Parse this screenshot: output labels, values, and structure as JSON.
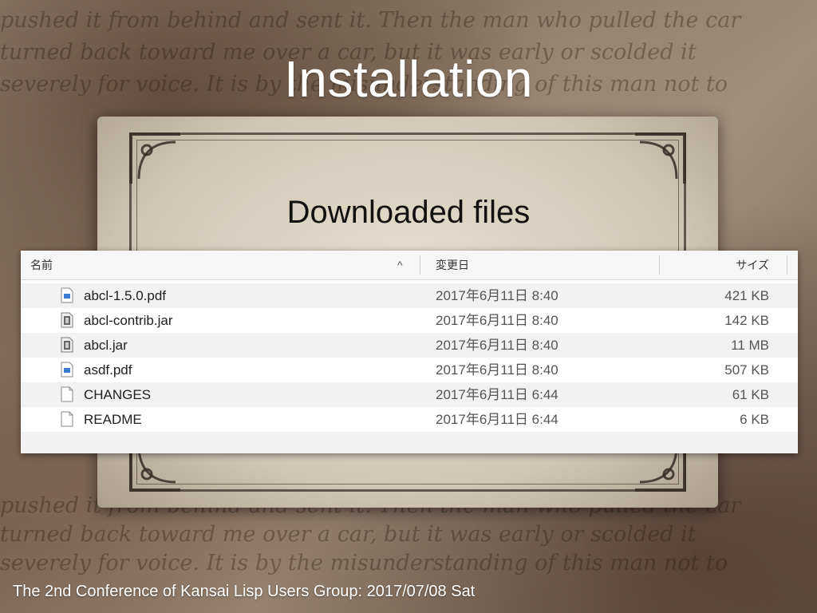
{
  "slide": {
    "title": "Installation",
    "subtitle": "Downloaded files",
    "footer": "The 2nd Conference of Kansai Lisp Users Group: 2017/07/08 Sat"
  },
  "background_script": [
    "pushed it from behind and sent it. Then the man who pulled the car",
    "turned back toward me over a car, but it was early or scolded it",
    "severely for voice. It is by the misunderstanding of this man not to",
    "pushed it from behind and sent it. Then the man who pulled the car",
    "turned back toward me over a car, but it was early or scolded it",
    "severely for voice. It is by the misunderstanding of this man not to"
  ],
  "finder": {
    "columns": {
      "name": "名前",
      "date": "変更日",
      "size": "サイズ",
      "sort_indicator": "^"
    },
    "files": [
      {
        "icon": "pdf-file-icon",
        "name": "abcl-1.5.0.pdf",
        "date": "2017年6月11日 8:40",
        "size": "421 KB"
      },
      {
        "icon": "jar-file-icon",
        "name": "abcl-contrib.jar",
        "date": "2017年6月11日 8:40",
        "size": "142 KB"
      },
      {
        "icon": "jar-file-icon",
        "name": "abcl.jar",
        "date": "2017年6月11日 8:40",
        "size": "11 MB"
      },
      {
        "icon": "pdf-file-icon",
        "name": "asdf.pdf",
        "date": "2017年6月11日 8:40",
        "size": "507 KB"
      },
      {
        "icon": "document-file-icon",
        "name": "CHANGES",
        "date": "2017年6月11日 6:44",
        "size": "61 KB"
      },
      {
        "icon": "document-file-icon",
        "name": "README",
        "date": "2017年6月11日 6:44",
        "size": "6 KB"
      }
    ]
  }
}
